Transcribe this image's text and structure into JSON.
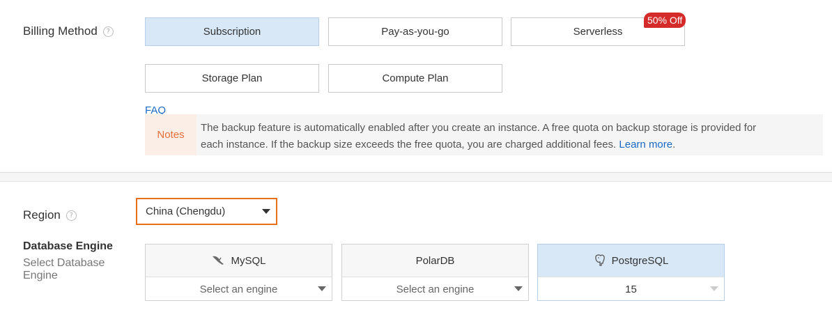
{
  "billing": {
    "label": "Billing Method",
    "options": [
      "Subscription",
      "Pay-as-you-go",
      "Serverless",
      "Storage Plan",
      "Compute Plan"
    ],
    "selected": "Subscription",
    "badge": "50% Off",
    "faq": "FAQ"
  },
  "notes": {
    "tag": "Notes",
    "text_line1": "The backup feature is automatically enabled after you create an instance. A free quota on backup storage is provided for",
    "text_line2": "each instance. If the backup size exceeds the free quota, you are charged additional fees.",
    "link": "Learn more",
    "period": "."
  },
  "region": {
    "label": "Region",
    "value": "China (Chengdu)"
  },
  "engine": {
    "title": "Database Engine",
    "subtitle": "Select Database Engine",
    "cards": [
      {
        "name": "MySQL",
        "icon": "dolphin-icon",
        "select": "Select an engine"
      },
      {
        "name": "PolarDB",
        "icon": "",
        "select": "Select an engine"
      },
      {
        "name": "PostgreSQL",
        "icon": "elephant-icon",
        "select": "15"
      }
    ],
    "selected": "PostgreSQL"
  },
  "colors": {
    "accent": "#e8701a",
    "selected_bg": "#d8e8f7",
    "badge": "#d42a2a",
    "link": "#1a6ac4"
  }
}
